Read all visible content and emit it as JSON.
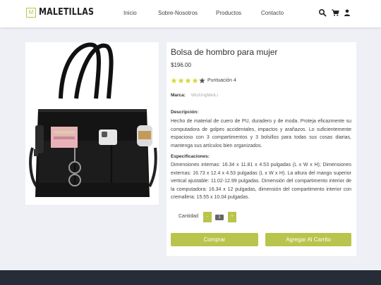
{
  "brand": {
    "logo_letter": "M",
    "name": "MALETILLAS"
  },
  "nav": {
    "home": "Inicio",
    "about": "Sobre-Nosotros",
    "products": "Productos",
    "contact": "Contacto"
  },
  "product": {
    "title": "Bolsa de hombro para mujer",
    "price": "$196.00",
    "rating_label": "Puntuación 4",
    "rating": 4,
    "rating_max": 5,
    "brand_label": "Marca:",
    "brand_value": "WuXingMeiLi",
    "description_label": "Descripción:",
    "description": "Hecho de material de cuero de PU, duradero y de moda. Proteja eficazmente su computadora de golpes accidentales, impactos y arañazos. Lo suficientemente espacioso con 3 compartimentos y 3 bolsillos para todas sus cosas diarias, mantenga sus artículos bien organizados.",
    "specs_label": "Especificaciones:",
    "specs": "Dimensiones internas: 16.34 x 11.81 x 4.53 pulgadas (L x W x H); Dimensiones externas: 16.73 x 12.4 x 4.53 pulgadas (L x W x H). La altura del mango superior vertical ajustable: 11.02-12.99 pulgadas. Dimensión del compartimento interior de la computadora: 16.34 x 12 pulgadas, dimensión del compartimento interior con cremallera: 15.55 x 10.04 pulgadas.",
    "quantity_label": "Cantidad",
    "minus": "-",
    "quantity": "1",
    "plus": "+",
    "buy_label": "Comprar",
    "add_cart_label": "Agregar Al Carrito"
  },
  "colors": {
    "accent": "#b9c44c",
    "footer": "#262d37",
    "background": "#eef0f6"
  }
}
